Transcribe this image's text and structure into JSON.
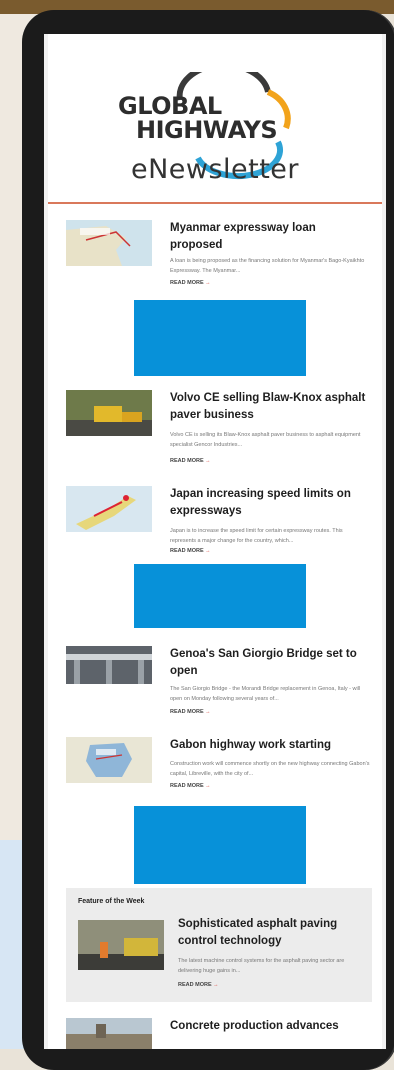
{
  "brand": {
    "line1": "GLOBAL",
    "line2": "HIGHWAYS",
    "subtitle": "eNewsletter"
  },
  "articles": [
    {
      "title": "Myanmar expressway loan proposed",
      "body": "A loan is being proposed as the financing solution for Myanmar's Bago-Kyaikhto Expressway. The Myanmar...",
      "more": "READ MORE"
    },
    {
      "title": "Volvo CE selling Blaw-Knox asphalt paver business",
      "body": "Volvo CE is selling its Blaw-Knox asphalt paver business to asphalt equipment specialist Gencor Industries...",
      "more": "READ MORE"
    },
    {
      "title": "Japan increasing speed limits on expressways",
      "body": "Japan is to increase the speed limit for certain expressway routes. This represents a major change for the country, which...",
      "more": "READ MORE"
    },
    {
      "title": "Genoa's San Giorgio Bridge set to open",
      "body": "The San Giorgio Bridge - the Morandi Bridge replacement in Genoa, Italy - will open on Monday following several years of...",
      "more": "READ MORE"
    },
    {
      "title": "Gabon highway work starting",
      "body": "Construction work will commence shortly on the new highway connecting Gabon's capital, Libreville, with the city of...",
      "more": "READ MORE"
    }
  ],
  "feature": {
    "label": "Feature of the Week",
    "title": "Sophisticated asphalt paving control technology",
    "body": "The latest machine control systems for the asphalt paving sector are delivering huge gains in...",
    "more": "READ MORE"
  },
  "last_article": {
    "title": "Concrete production advances"
  },
  "icons": {
    "arrow": "arrow-right-icon"
  },
  "colors": {
    "accent_rule": "#d9785b",
    "ad_blue": "#0791d9",
    "read_more_arrow": "#d9463b"
  }
}
